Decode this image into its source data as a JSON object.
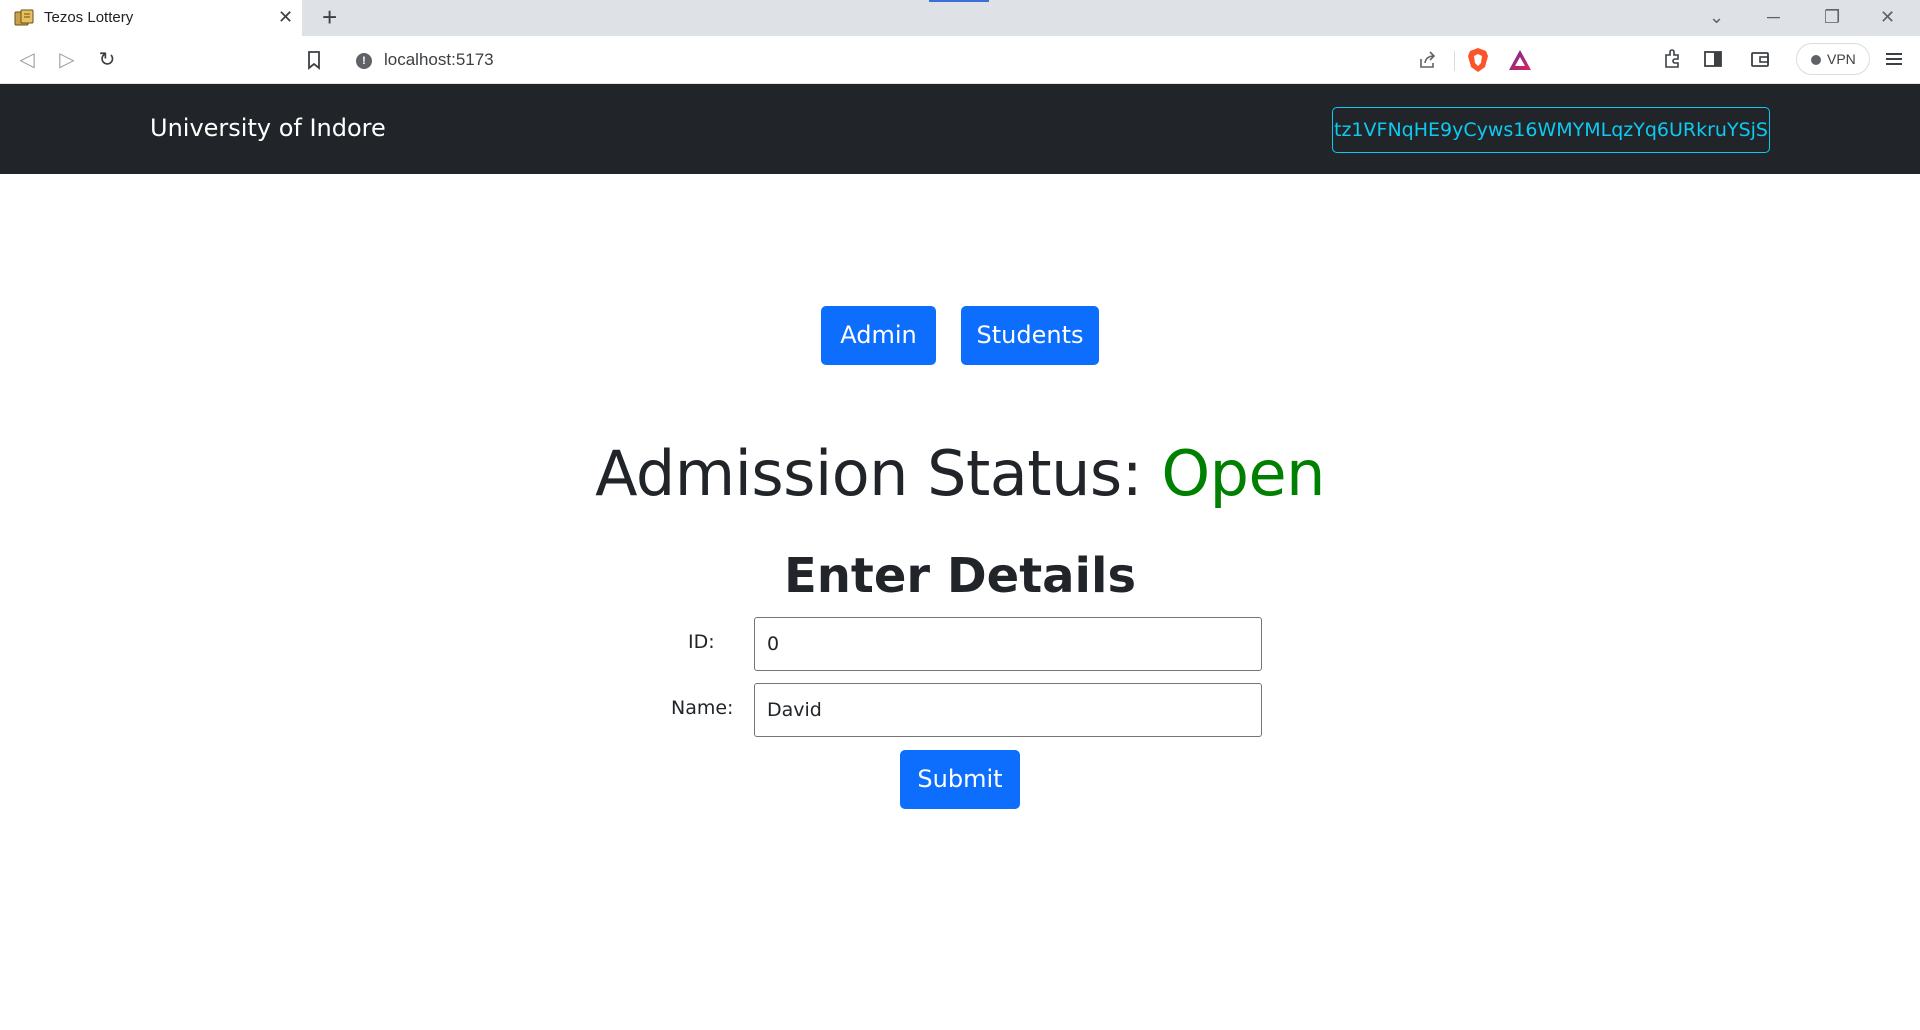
{
  "browser": {
    "tab_title": "Tezos Lottery",
    "tab_close": "✕",
    "new_tab": "+",
    "url": "localhost:5173",
    "vpn_label": "VPN",
    "info_glyph": "!",
    "window_controls": {
      "minimize": "─",
      "restore": "❐",
      "close": "✕",
      "tab_search": "⌄"
    },
    "nav": {
      "back": "◁",
      "forward": "▷",
      "reload": "↻"
    }
  },
  "navbar": {
    "brand": "University of Indore",
    "wallet_address": "tz1VFNqHE9yCyws16WMYMLqzYq6URkruYSjS"
  },
  "tabs": {
    "admin": "Admin",
    "students": "Students"
  },
  "status": {
    "label": "Admission Status: ",
    "value": "Open",
    "value_color": "#008000"
  },
  "form": {
    "title": "Enter Details",
    "id_label": "ID:",
    "id_value": "0",
    "name_label": "Name:",
    "name_value": "David",
    "submit_label": "Submit"
  },
  "colors": {
    "primary": "#0d6efd",
    "navbar_bg": "#212529",
    "info": "#0dcaf0"
  }
}
